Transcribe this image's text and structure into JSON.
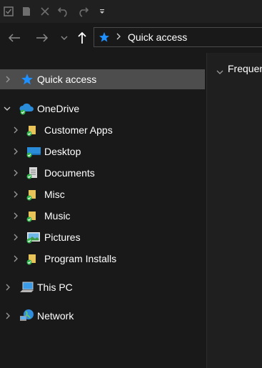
{
  "quick_access_toolbar": {
    "icons": [
      "properties-icon",
      "new-folder-icon",
      "delete-icon",
      "undo-icon",
      "redo-icon",
      "customize-dropdown-icon"
    ]
  },
  "nav": {
    "back_icon": "back-arrow-icon",
    "forward_icon": "forward-arrow-icon",
    "recent_icon": "recent-locations-chevron-icon",
    "up_icon": "up-arrow-icon"
  },
  "address_bar": {
    "icon": "star-icon",
    "path": "Quick access"
  },
  "tree": {
    "quick_access": {
      "label": "Quick access",
      "selected": true
    },
    "onedrive": {
      "label": "OneDrive",
      "expanded": true,
      "children": [
        {
          "label": "Customer Apps",
          "icon": "folder-synced-icon"
        },
        {
          "label": "Desktop",
          "icon": "desktop-synced-icon"
        },
        {
          "label": "Documents",
          "icon": "documents-synced-icon"
        },
        {
          "label": "Misc",
          "icon": "folder-synced-icon"
        },
        {
          "label": "Music",
          "icon": "folder-synced-icon"
        },
        {
          "label": "Pictures",
          "icon": "pictures-synced-icon"
        },
        {
          "label": "Program Installs",
          "icon": "folder-synced-icon"
        }
      ]
    },
    "this_pc": {
      "label": "This PC"
    },
    "network": {
      "label": "Network"
    }
  },
  "content": {
    "section_header": "Frequen"
  },
  "colors": {
    "background": "#191919",
    "selected_row": "#4d4d4d",
    "accent_star": "#1e90ff",
    "onedrive_blue": "#2a8bd8",
    "sync_green": "#2fb34a",
    "folder_yellow": "#e8c35a"
  }
}
